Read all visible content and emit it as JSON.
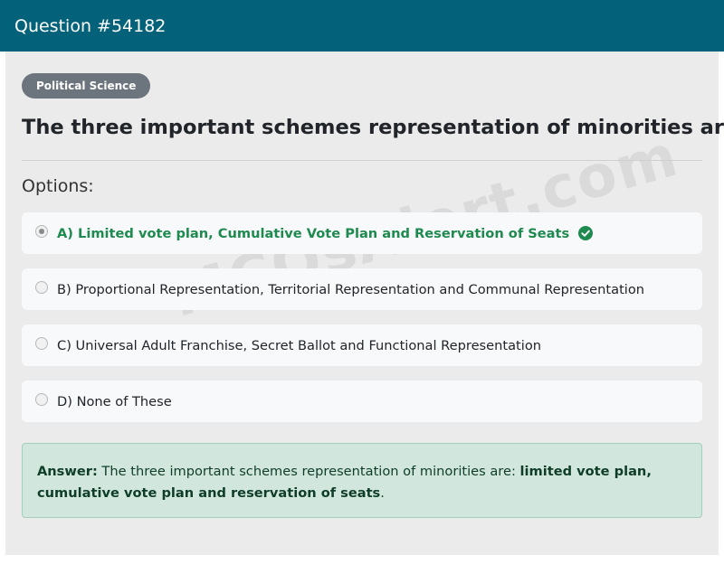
{
  "header": {
    "title": "Question #54182"
  },
  "category": "Political Science",
  "question": "The three important schemes representation of minorities are:",
  "options_label": "Options:",
  "options": [
    {
      "label": "A) Limited vote plan, Cumulative Vote Plan and Reservation of Seats",
      "selected": true,
      "correct": true
    },
    {
      "label": "B) Proportional Representation, Territorial Representation and Communal Representation",
      "selected": false
    },
    {
      "label": "C) Universal Adult Franchise, Secret Ballot and Functional Representation",
      "selected": false
    },
    {
      "label": "D) None of These",
      "selected": false
    }
  ],
  "answer": {
    "label": "Answer:",
    "text": " The three important schemes representation of minorities are: ",
    "highlight": "limited vote plan, cumulative vote plan and reservation of seats",
    "end": "."
  },
  "watermark": "MCQsAlert.com",
  "colors": {
    "header": "#036279",
    "correct": "#1e8a4f",
    "answer_bg": "#d1e7dd"
  }
}
